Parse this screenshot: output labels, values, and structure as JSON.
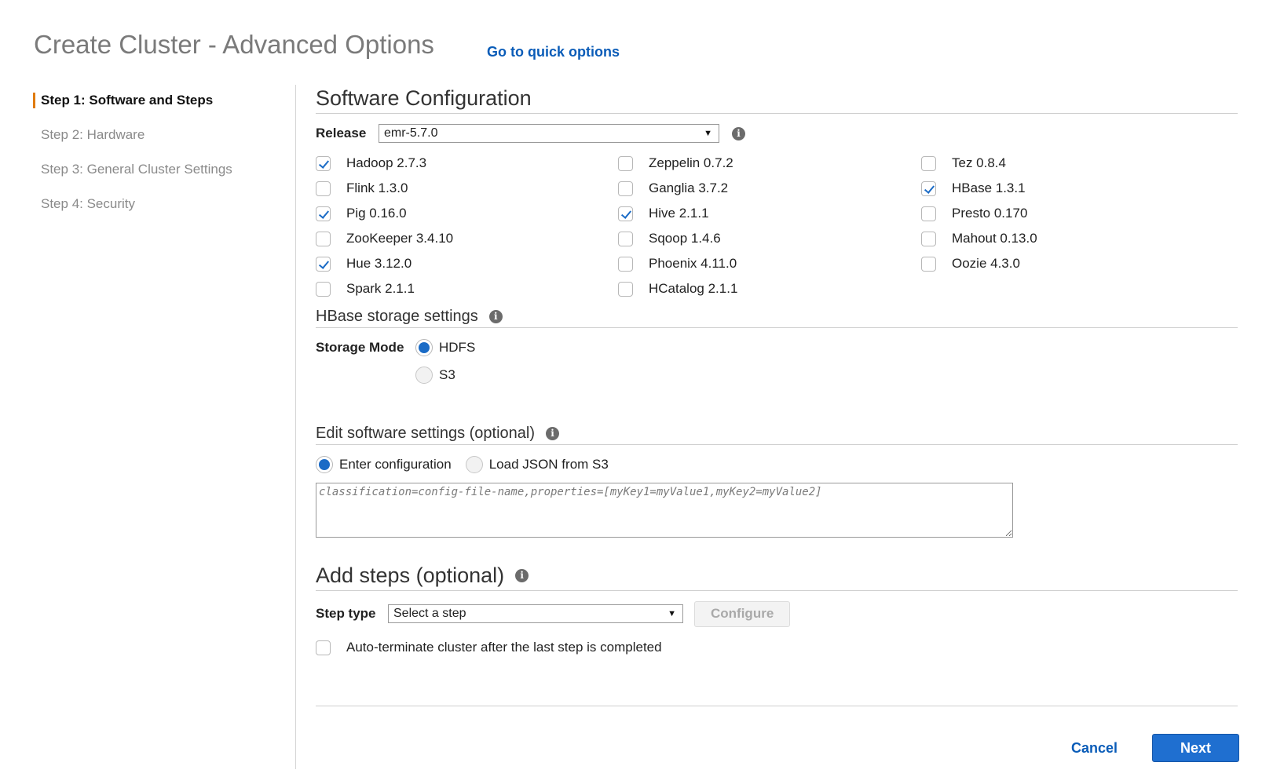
{
  "header": {
    "title": "Create Cluster - Advanced Options",
    "quick_link": "Go to quick options"
  },
  "sidebar": {
    "steps": [
      {
        "label": "Step 1: Software and Steps",
        "active": true
      },
      {
        "label": "Step 2: Hardware",
        "active": false
      },
      {
        "label": "Step 3: General Cluster Settings",
        "active": false
      },
      {
        "label": "Step 4: Security",
        "active": false
      }
    ]
  },
  "software": {
    "title": "Software Configuration",
    "release_label": "Release",
    "release_value": "emr-5.7.0",
    "applications": [
      {
        "label": "Hadoop 2.7.3",
        "checked": true
      },
      {
        "label": "Flink 1.3.0",
        "checked": false
      },
      {
        "label": "Pig 0.16.0",
        "checked": true
      },
      {
        "label": "ZooKeeper 3.4.10",
        "checked": false
      },
      {
        "label": "Hue 3.12.0",
        "checked": true
      },
      {
        "label": "Spark 2.1.1",
        "checked": false
      },
      {
        "label": "Zeppelin 0.7.2",
        "checked": false
      },
      {
        "label": "Ganglia 3.7.2",
        "checked": false
      },
      {
        "label": "Hive 2.1.1",
        "checked": true
      },
      {
        "label": "Sqoop 1.4.6",
        "checked": false
      },
      {
        "label": "Phoenix 4.11.0",
        "checked": false
      },
      {
        "label": "HCatalog 2.1.1",
        "checked": false
      },
      {
        "label": "Tez 0.8.4",
        "checked": false
      },
      {
        "label": "HBase 1.3.1",
        "checked": true
      },
      {
        "label": "Presto 0.170",
        "checked": false
      },
      {
        "label": "Mahout 0.13.0",
        "checked": false
      },
      {
        "label": "Oozie 4.3.0",
        "checked": false
      }
    ]
  },
  "hbase": {
    "title": "HBase storage settings",
    "storage_mode_label": "Storage Mode",
    "options": [
      {
        "label": "HDFS",
        "selected": true
      },
      {
        "label": "S3",
        "selected": false
      }
    ]
  },
  "edit_settings": {
    "title": "Edit software settings (optional)",
    "options": [
      {
        "label": "Enter configuration",
        "selected": true
      },
      {
        "label": "Load JSON from S3",
        "selected": false
      }
    ],
    "placeholder": "classification=config-file-name,properties=[myKey1=myValue1,myKey2=myValue2]"
  },
  "steps": {
    "title": "Add steps (optional)",
    "step_type_label": "Step type",
    "step_type_value": "Select a step",
    "configure_label": "Configure",
    "auto_terminate_label": "Auto-terminate cluster after the last step is completed",
    "auto_terminate_checked": false
  },
  "footer": {
    "cancel_label": "Cancel",
    "next_label": "Next"
  },
  "colors": {
    "accent": "#1f6fd0",
    "link": "#0a5cb8",
    "active_step_marker": "#e07b0f"
  }
}
